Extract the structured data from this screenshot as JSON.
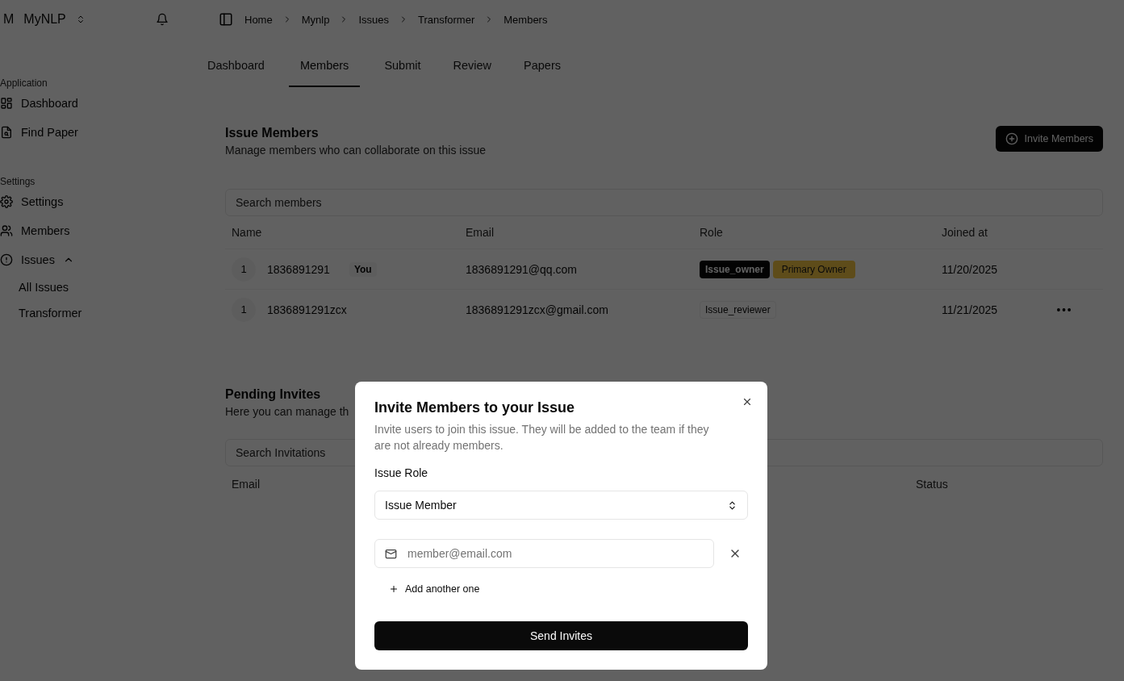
{
  "sidebar": {
    "workspace": {
      "initial": "M",
      "name": "MyNLP"
    },
    "groups": [
      {
        "label": "Application",
        "items": [
          {
            "label": "Dashboard"
          },
          {
            "label": "Find Paper"
          }
        ]
      },
      {
        "label": "Settings",
        "items": [
          {
            "label": "Settings"
          },
          {
            "label": "Members"
          },
          {
            "label": "Issues",
            "expanded": true,
            "children": [
              {
                "label": "All Issues"
              },
              {
                "label": "Transformer"
              }
            ]
          }
        ]
      }
    ]
  },
  "breadcrumb": [
    "Home",
    "Mynlp",
    "Issues",
    "Transformer",
    "Members"
  ],
  "tabs": [
    {
      "label": "Dashboard",
      "selected": false
    },
    {
      "label": "Members",
      "selected": true
    },
    {
      "label": "Submit",
      "selected": false
    },
    {
      "label": "Review",
      "selected": false
    },
    {
      "label": "Papers",
      "selected": false
    }
  ],
  "members_section": {
    "title": "Issue Members",
    "subtitle": "Manage members who can collaborate on this issue",
    "invite_button": "Invite Members",
    "search": {
      "placeholder": "Search members"
    },
    "columns": [
      "Name",
      "Email",
      "Role",
      "Joined at"
    ],
    "rows": [
      {
        "avatar": "1",
        "name": "1836891291",
        "badge": "You",
        "email": "1836891291@qq.com",
        "roles": [
          {
            "label": "Issue_owner",
            "kind": "solid"
          },
          {
            "label": "Primary Owner",
            "kind": "primary"
          }
        ],
        "joined": "11/20/2025",
        "has_menu": false
      },
      {
        "avatar": "1",
        "name": "1836891291zcx",
        "email": "1836891291zcx@gmail.com",
        "roles": [
          {
            "label": "Issue_reviewer",
            "kind": "outline"
          }
        ],
        "joined": "11/21/2025",
        "has_menu": true
      }
    ]
  },
  "pending_section": {
    "title": "Pending Invites",
    "subtitle": "Here you can manage th",
    "search": {
      "placeholder": "Search Invitations"
    },
    "columns": [
      "Email",
      "Status"
    ]
  },
  "dialog": {
    "title": "Invite Members to your Issue",
    "description": "Invite users to join this issue. They will be added to the team if they are not already members.",
    "role_label": "Issue Role",
    "role_select": "Issue Member",
    "email_field": {
      "placeholder": "member@email.com"
    },
    "add_link": "Add another one",
    "submit": "Send Invites"
  }
}
